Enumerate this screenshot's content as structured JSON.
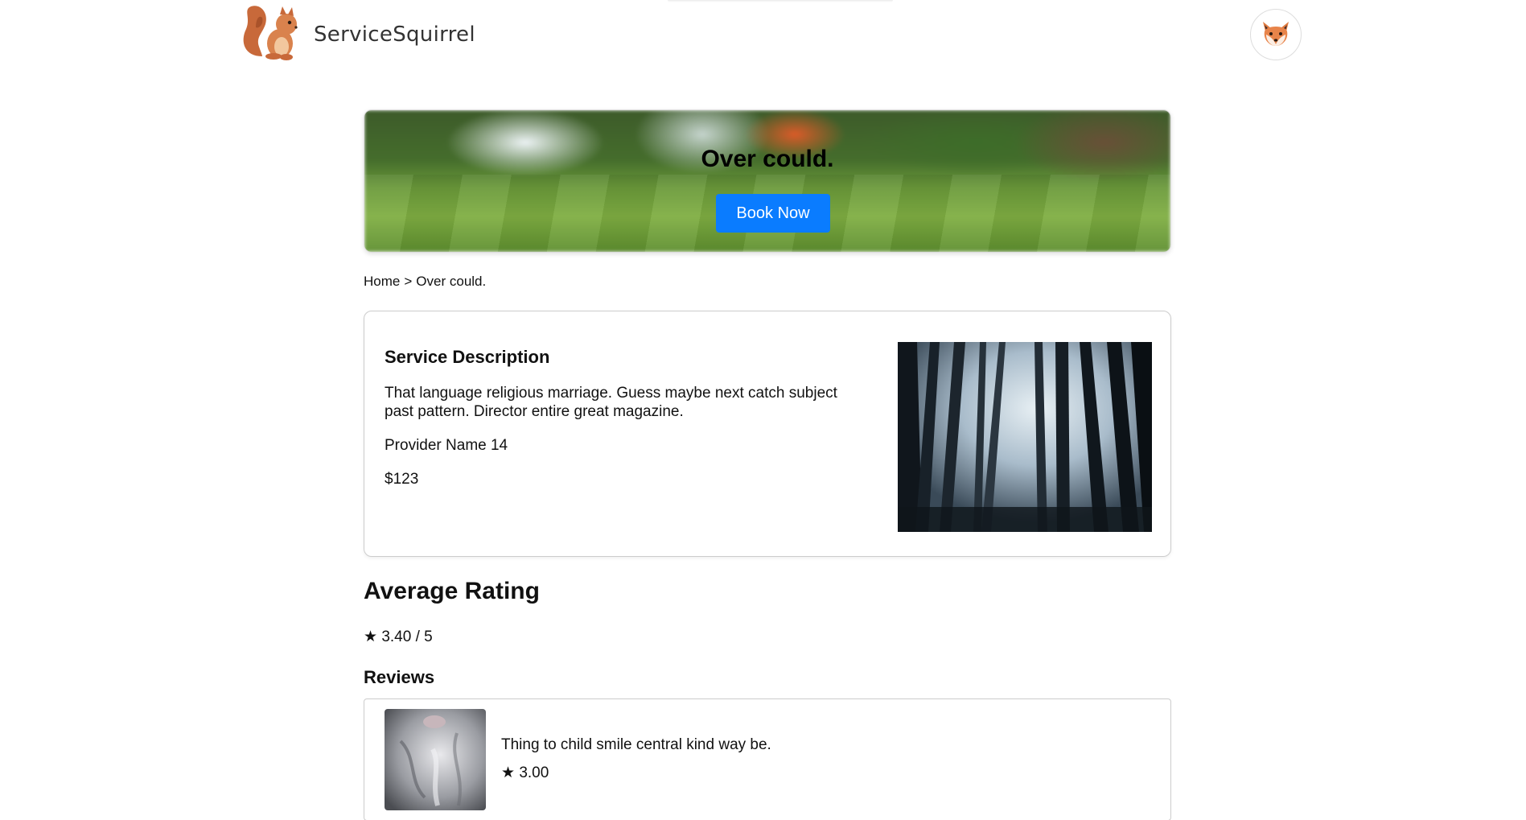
{
  "header": {
    "brand": "ServiceSquirrel",
    "logo_icon": "squirrel-icon",
    "avatar_icon": "fox-icon"
  },
  "hero": {
    "title": "Over could.",
    "book_label": "Book Now",
    "accent": "#0a7cff"
  },
  "breadcrumb": {
    "home": "Home",
    "separator": ">",
    "current": "Over could."
  },
  "service": {
    "heading": "Service Description",
    "description": "That language religious marriage. Guess maybe next catch subject past pattern. Director entire great magazine.",
    "provider": "Provider Name 14",
    "price": "$123"
  },
  "rating": {
    "heading": "Average Rating",
    "star": "★",
    "value": "3.40 / 5"
  },
  "reviews": {
    "heading": "Reviews",
    "items": [
      {
        "text": "Thing to child smile central kind way be.",
        "star": "★",
        "rating": "3.00"
      }
    ]
  }
}
